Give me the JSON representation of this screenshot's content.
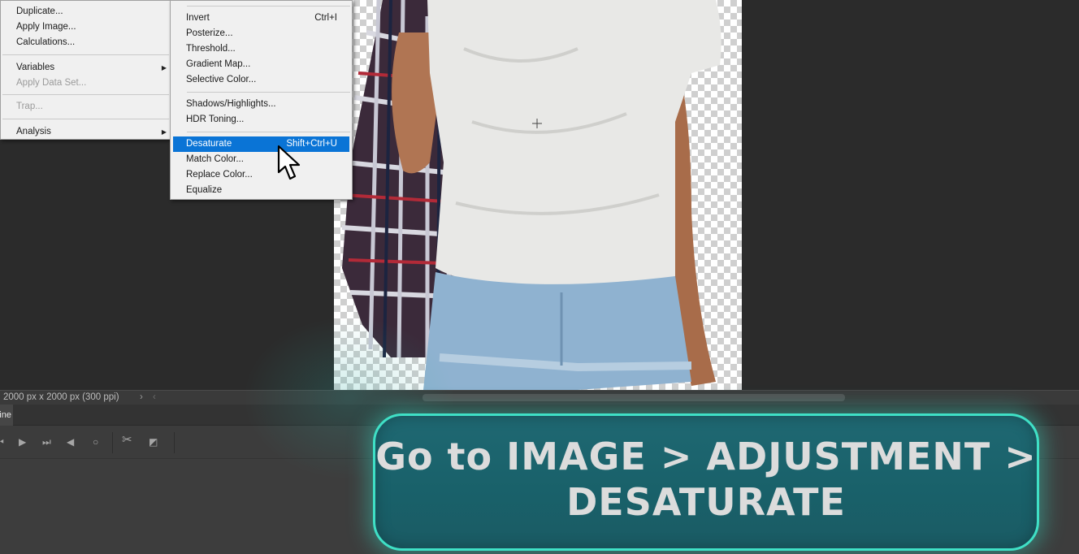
{
  "left_menu": {
    "items": [
      {
        "label": "Duplicate...",
        "disabled": false,
        "submenu": false
      },
      {
        "label": "Apply Image...",
        "disabled": false,
        "submenu": false
      },
      {
        "label": "Calculations...",
        "disabled": false,
        "submenu": false
      },
      {
        "label": "Variables",
        "disabled": false,
        "submenu": true
      },
      {
        "label": "Apply Data Set...",
        "disabled": true,
        "submenu": false
      },
      {
        "label": "Trap...",
        "disabled": true,
        "submenu": false
      },
      {
        "label": "Analysis",
        "disabled": false,
        "submenu": true
      }
    ]
  },
  "adjustments_menu": {
    "items": [
      {
        "label": "Invert",
        "shortcut": "Ctrl+I"
      },
      {
        "label": "Posterize...",
        "shortcut": ""
      },
      {
        "label": "Threshold...",
        "shortcut": ""
      },
      {
        "label": "Gradient Map...",
        "shortcut": ""
      },
      {
        "label": "Selective Color...",
        "shortcut": ""
      },
      {
        "label": "Shadows/Highlights...",
        "shortcut": ""
      },
      {
        "label": "HDR Toning...",
        "shortcut": ""
      },
      {
        "label": "Desaturate",
        "shortcut": "Shift+Ctrl+U",
        "highlighted": true
      },
      {
        "label": "Match Color...",
        "shortcut": ""
      },
      {
        "label": "Replace Color...",
        "shortcut": ""
      },
      {
        "label": "Equalize",
        "shortcut": ""
      }
    ]
  },
  "status_bar": {
    "doc_size": "2000 px x 2000 px (300 ppi)",
    "arrow": "›",
    "scroll_left": "‹"
  },
  "timeline": {
    "tab_label": "Timeline",
    "controls": [
      "⏮",
      "▶",
      "⏭",
      "◀",
      "○",
      "✂",
      "◩"
    ]
  },
  "caption": {
    "text": "Go to IMAGE > ADJUSTMENT > DESATURATE"
  },
  "colors": {
    "menu_highlight": "#0a74d6",
    "banner_border": "#3fe0c6",
    "banner_fill": "#1f6872"
  }
}
